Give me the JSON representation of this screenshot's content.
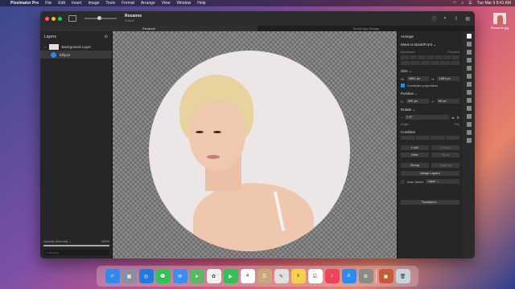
{
  "menubar": {
    "apple": "",
    "app_name": "Pixelmator Pro",
    "menus": [
      "File",
      "Edit",
      "Insert",
      "Image",
      "Tools",
      "Format",
      "Arrange",
      "View",
      "Window",
      "Help"
    ],
    "clock": "Tue Mar 9  9:41 AM"
  },
  "desktop": {
    "file_label": "Roxanne.jpg"
  },
  "window": {
    "title": "Roxanne",
    "subtitle": "Edited",
    "tabs": [
      "Roxanne",
      "Social App Design"
    ]
  },
  "layers": {
    "title": "Layers",
    "items": [
      {
        "name": "Background Layer"
      },
      {
        "name": "Ellipse"
      }
    ],
    "opacity_label": "Opacity (Normal) ⌄",
    "opacity_value": "100%",
    "opacity_fraction": 1.0,
    "search_placeholder": "Search"
  },
  "inspector": {
    "title": "Arrange",
    "move_title": "Move to Back/Front ⌄",
    "backward": "Backward",
    "forward": "Forward",
    "size_title": "Size ⌄",
    "w_label": "W:",
    "w_value": "1881 px",
    "h_label": "H:",
    "h_value": "1881 px",
    "constrain": "Constrain proportions",
    "position_title": "Position ⌄",
    "x_label": "X:",
    "x_value": "282 px",
    "y_label": "Y:",
    "y_value": "50 px",
    "rotate_title": "Rotate ⌄",
    "angle_value": "0.0°",
    "angle_label": "Angle",
    "flip_label": "Flip",
    "combine_title": "Combine",
    "lock": "Lock",
    "unlock": "Unlock",
    "hide": "Hide",
    "show": "Show",
    "group": "Group",
    "ungroup": "Ungroup",
    "merge": "Merge Layers",
    "auto_select": "Auto Select",
    "auto_select_value": "Layer ⌄",
    "transform": "Transform..."
  },
  "dock": {
    "apps": [
      {
        "icon": "finder-icon",
        "color": "#2a8cf0",
        "glyph": "☺"
      },
      {
        "icon": "launchpad-icon",
        "color": "#8a8fa0",
        "glyph": "▦"
      },
      {
        "icon": "safari-icon",
        "color": "#1e7be0",
        "glyph": "◎"
      },
      {
        "icon": "messages-icon",
        "color": "#2fc552",
        "glyph": "💬"
      },
      {
        "icon": "mail-icon",
        "color": "#3a8ef0",
        "glyph": "✉"
      },
      {
        "icon": "maps-icon",
        "color": "#58b868",
        "glyph": "➤"
      },
      {
        "icon": "photos-icon",
        "color": "#f2f2f2",
        "glyph": "✿"
      },
      {
        "icon": "facetime-icon",
        "color": "#2ec455",
        "glyph": "▶"
      },
      {
        "icon": "calendar-icon",
        "color": "#ffffff",
        "glyph": "4"
      },
      {
        "icon": "contacts-icon",
        "color": "#c8a878",
        "glyph": "☰"
      },
      {
        "icon": "pixelmator-icon",
        "color": "#e0e0e0",
        "glyph": "✎"
      },
      {
        "icon": "notes-icon",
        "color": "#f5d24a",
        "glyph": "≡"
      },
      {
        "icon": "reminders-icon",
        "color": "#ffffff",
        "glyph": "☑"
      },
      {
        "icon": "music-icon",
        "color": "#f0425a",
        "glyph": "♪"
      },
      {
        "icon": "appstore-icon",
        "color": "#2a8cf0",
        "glyph": "A"
      },
      {
        "icon": "settings-icon",
        "color": "#8a8a8a",
        "glyph": "⚙"
      },
      {
        "icon": "downloads-icon",
        "color": "#c85a3a",
        "glyph": "▣"
      },
      {
        "icon": "trash-icon",
        "color": "#c9d3de",
        "glyph": "🗑"
      }
    ]
  }
}
